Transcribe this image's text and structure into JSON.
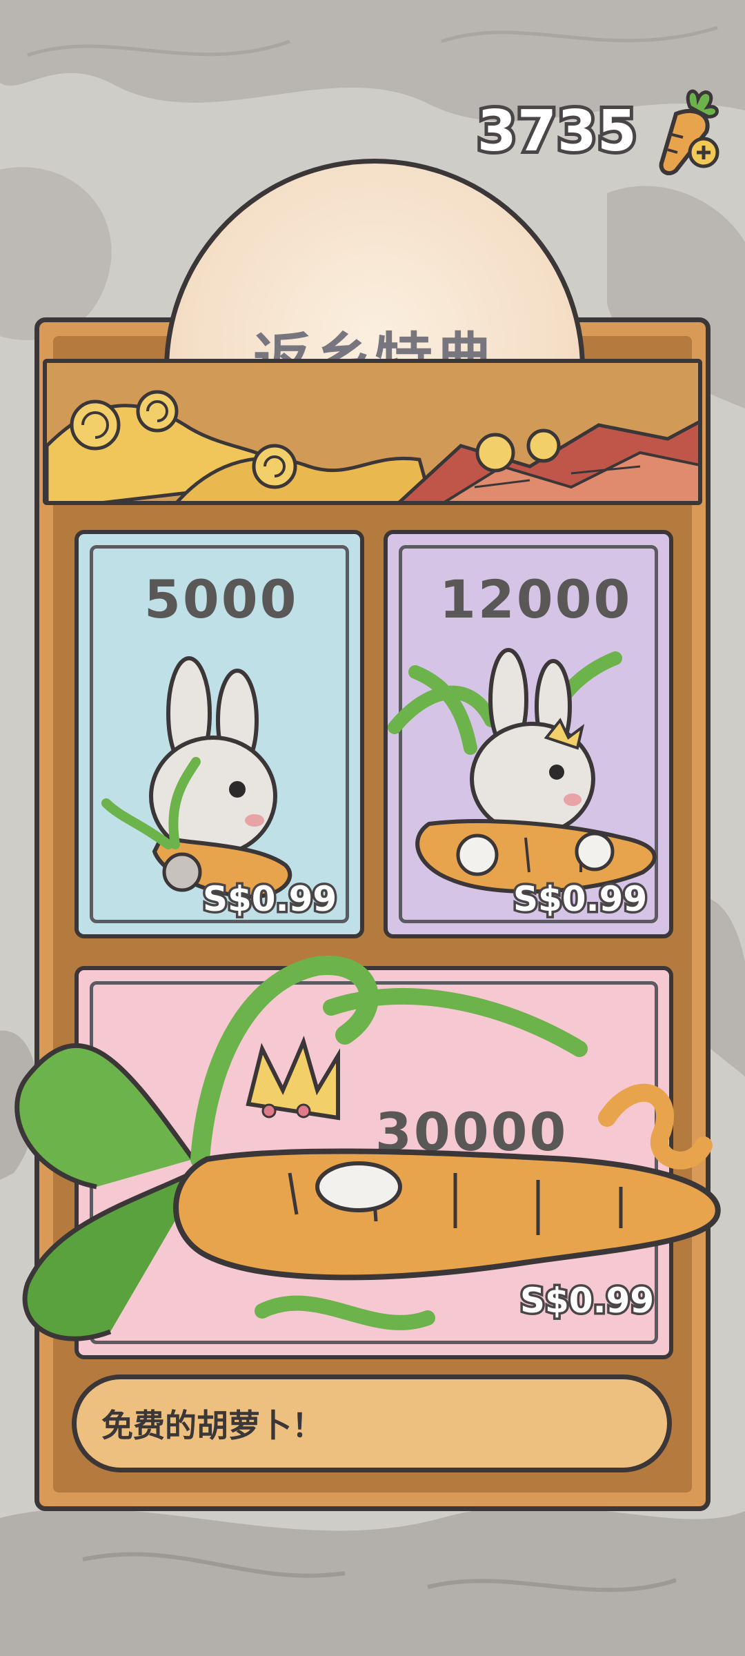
{
  "currency": {
    "amount": "3735",
    "icon": "carrot-plus-icon"
  },
  "offer": {
    "title": "返乡特典"
  },
  "packs": [
    {
      "amount": "5000",
      "price": "S$0.99",
      "bg": "#bfe0e6"
    },
    {
      "amount": "12000",
      "price": "S$0.99",
      "bg": "#d6c4e6"
    },
    {
      "amount": "30000",
      "price": "S$0.99",
      "bg": "#f6c9d2"
    }
  ],
  "free_button": {
    "label": "免费的胡萝卜！"
  },
  "colors": {
    "panel": "#d89a56",
    "outline": "#3b3637",
    "leaf": "#6db34c",
    "carrot": "#e8a34d"
  }
}
